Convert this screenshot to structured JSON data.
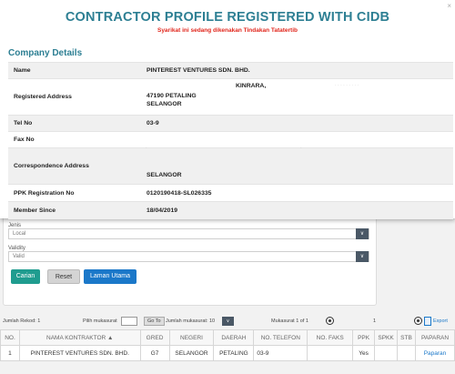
{
  "modal": {
    "close_glyph": "×",
    "title": "CONTRACTOR PROFILE REGISTERED WITH CIDB",
    "subtitle": "Syarikat ini sedang dikenakan Tindakan Tatatertib",
    "section_title": "Company Details",
    "rows": [
      {
        "label": "Name",
        "value": "PINTEREST VENTURES SDN. BHD."
      },
      {
        "label": "Registered Address",
        "extra": "KINRARA,",
        "value_line1": "47190 PETALING",
        "value_line2": "SELANGOR"
      },
      {
        "label": "Tel No",
        "value": "03-9"
      },
      {
        "label": "Fax No",
        "value": ""
      },
      {
        "label": "Correspondence Address",
        "value": "SELANGOR"
      },
      {
        "label": "PPK Registration No",
        "value": "0120190418-SL026335"
      },
      {
        "label": "Member Since",
        "value": "18/04/2019"
      }
    ]
  },
  "search": {
    "jenis_label": "Jenis",
    "jenis_value": "Local",
    "validity_label": "Validity",
    "validity_value": "Valid",
    "arrow_glyph": "∨",
    "cari_label": "Carian",
    "reset_label": "Reset",
    "laman_label": "Laman Utama"
  },
  "pager": {
    "jumlah_rekod": "Jumlah Rekod: 1",
    "pilih_label": "Pilih mukasurat",
    "go_label": "Go To",
    "jumlah_muka": "Jumlah mukasurat: 10",
    "mukasurat": "Mukasurat 1 of 1",
    "page_number": "1",
    "export_label": "Export"
  },
  "table": {
    "headers": [
      "NO.",
      "NAMA KONTRAKTOR ▲",
      "GRED",
      "NEGERI",
      "DAERAH",
      "NO. TELEFON",
      "NO. FAKS",
      "PPK",
      "SPKK",
      "STB",
      "PAPARAN"
    ],
    "row": [
      "1",
      "PINTEREST VENTURES SDN. BHD.",
      "G7",
      "SELANGOR",
      "PETALING",
      "03-9",
      "",
      "Yes",
      "",
      "",
      "Paparan"
    ]
  }
}
